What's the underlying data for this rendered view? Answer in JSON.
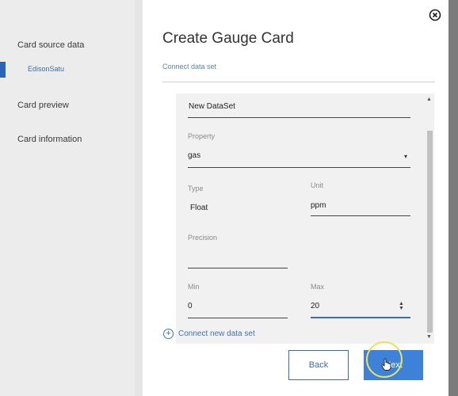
{
  "sidebar": {
    "items": [
      {
        "label": "Card source data"
      },
      {
        "label": "Card preview"
      },
      {
        "label": "Card information"
      }
    ],
    "sub_item": "EdisonSatu"
  },
  "dialog": {
    "title": "Create Gauge Card",
    "subtitle": "Connect data set",
    "close_icon": "close-circle-icon"
  },
  "form": {
    "dataset_name": "New DataSet",
    "property": {
      "label": "Property",
      "value": "gas"
    },
    "type": {
      "label": "Type",
      "value": "Float"
    },
    "unit": {
      "label": "Unit",
      "value": "ppm"
    },
    "precision": {
      "label": "Precision",
      "value": ""
    },
    "min": {
      "label": "Min",
      "value": "0"
    },
    "max": {
      "label": "Max",
      "value": "20"
    }
  },
  "connect_new_label": "Connect new data set",
  "buttons": {
    "back": "Back",
    "next": "Next"
  },
  "colors": {
    "accent": "#3d82d8",
    "link": "#3d74b4",
    "highlight": "#e8e35a"
  }
}
